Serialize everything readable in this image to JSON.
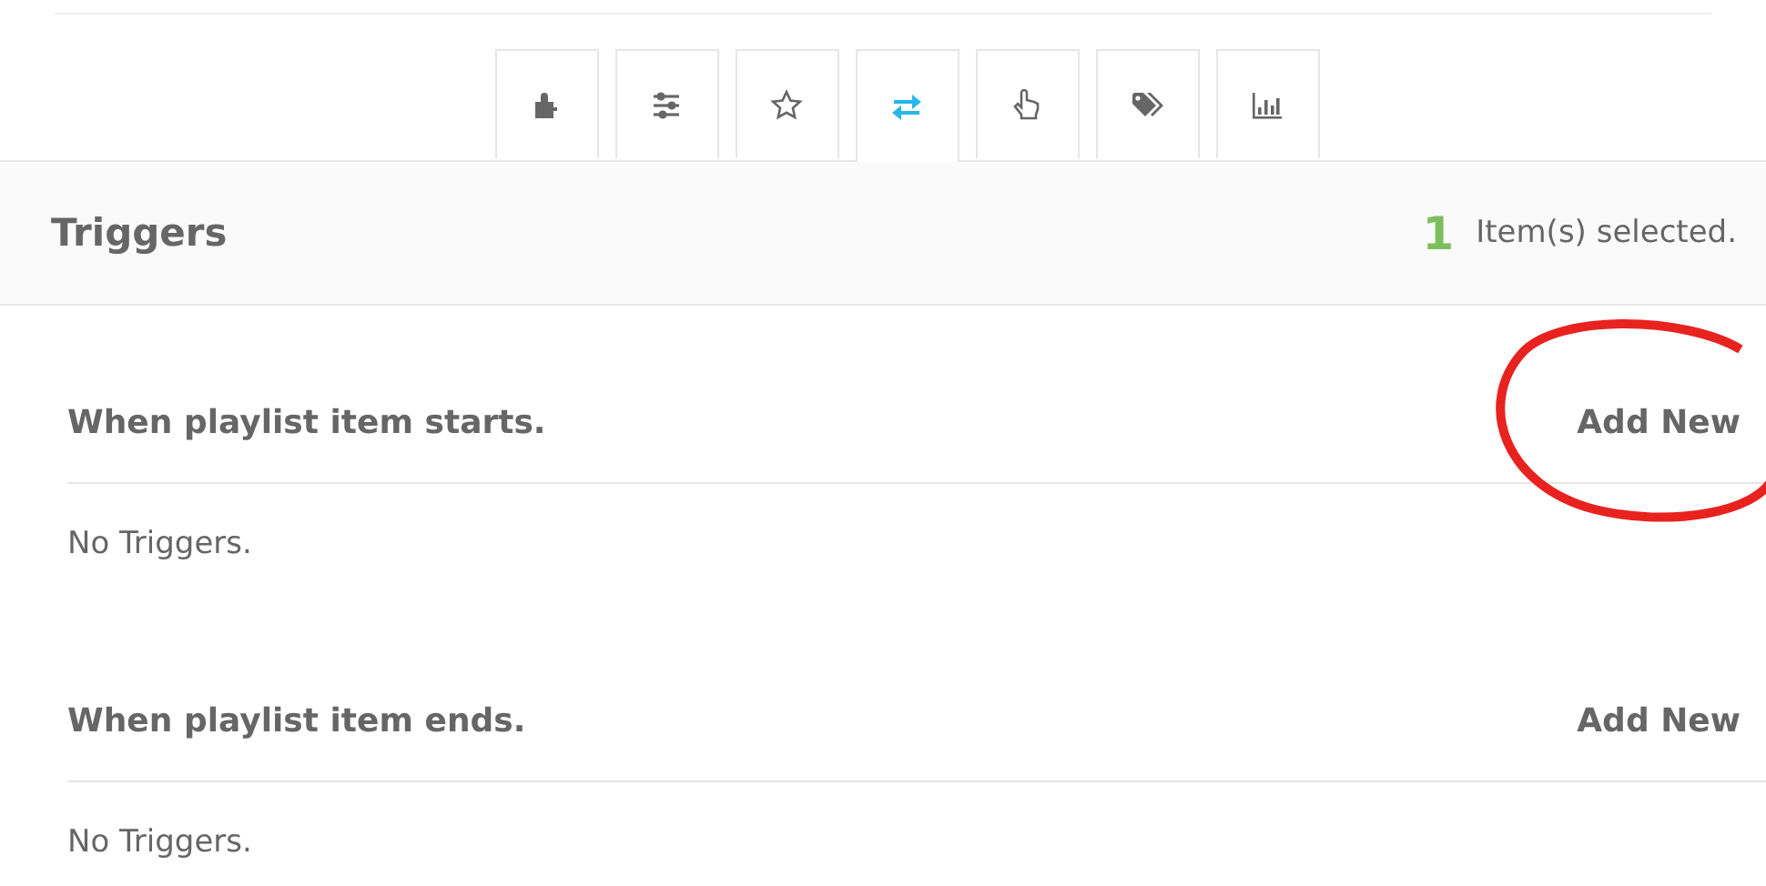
{
  "tabs": [
    {
      "selected": false
    },
    {
      "selected": false
    },
    {
      "selected": false
    },
    {
      "selected": true
    },
    {
      "selected": false
    },
    {
      "selected": false
    },
    {
      "selected": false
    }
  ],
  "panel": {
    "title": "Triggers",
    "selected_count": "1",
    "selected_label": "Item(s) selected."
  },
  "sections": [
    {
      "title": "When playlist item starts.",
      "action": "Add New",
      "empty_text": "No Triggers.",
      "circled": true
    },
    {
      "title": "When playlist item ends.",
      "action": "Add New",
      "empty_text": "No Triggers.",
      "circled": false
    }
  ]
}
